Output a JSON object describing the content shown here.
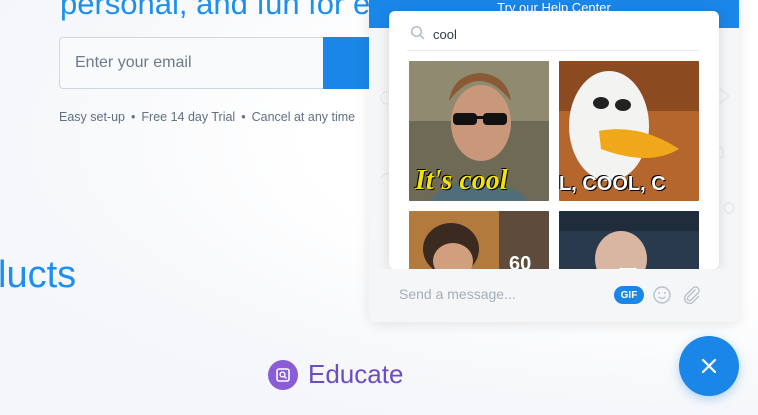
{
  "hero": {
    "headline_fragment": "personal, and fun for ev"
  },
  "signup": {
    "email_placeholder": "Enter your email",
    "features": [
      "Easy set-up",
      "Free 14 day Trial",
      "Cancel at any time"
    ],
    "separator": "•"
  },
  "sections": {
    "products_fragment": "lucts",
    "educate_label": "Educate"
  },
  "chat_widget": {
    "header_text": "Try our Help Center",
    "gif_search": {
      "query": "cool",
      "results": [
        {
          "icon": "gif-man-sunglasses",
          "caption": "It's cool"
        },
        {
          "icon": "gif-cartoon-stork",
          "caption": "L, COOL, C"
        },
        {
          "icon": "gif-man-curly-hair",
          "caption": "60"
        },
        {
          "icon": "gif-bald-man",
          "caption": ""
        }
      ]
    },
    "composer": {
      "placeholder": "Send a message...",
      "gif_button_label": "GIF",
      "emoji_icon": "smiley-icon",
      "attach_icon": "paperclip-icon"
    },
    "launcher_icon": "close-icon"
  },
  "colors": {
    "brand_blue": "#1a86e8",
    "educate_purple": "#6c4dc4"
  }
}
